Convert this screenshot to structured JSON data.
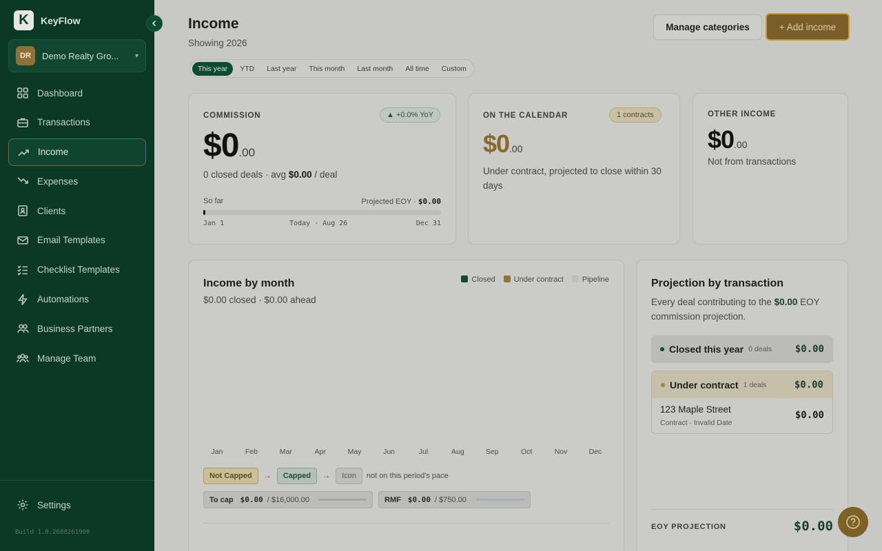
{
  "app": {
    "name": "KeyFlow",
    "logo_letter": "K",
    "build": "Build 1.0.2608261900"
  },
  "org": {
    "initials": "DR",
    "name": "Demo Realty Gro..."
  },
  "nav": [
    {
      "label": "Dashboard",
      "icon": "grid-icon"
    },
    {
      "label": "Transactions",
      "icon": "briefcase-icon"
    },
    {
      "label": "Income",
      "icon": "trend-up-icon",
      "active": true
    },
    {
      "label": "Expenses",
      "icon": "trend-down-icon"
    },
    {
      "label": "Clients",
      "icon": "contacts-icon"
    },
    {
      "label": "Email Templates",
      "icon": "mail-icon"
    },
    {
      "label": "Checklist Templates",
      "icon": "checklist-icon"
    },
    {
      "label": "Automations",
      "icon": "bolt-icon"
    },
    {
      "label": "Business Partners",
      "icon": "partners-icon"
    },
    {
      "label": "Manage Team",
      "icon": "team-icon"
    }
  ],
  "settings_label": "Settings",
  "header": {
    "title": "Income",
    "subtitle": "Showing 2026",
    "manage_label": "Manage categories",
    "add_label": "+ Add income"
  },
  "ranges": [
    "This year",
    "YTD",
    "Last year",
    "This month",
    "Last month",
    "All time",
    "Custom"
  ],
  "commission": {
    "label": "COMMISSION",
    "yoy": "▲ +0.0% YoY",
    "amount": "$0",
    "cents": ".00",
    "deals_prefix": "0 closed deals · avg ",
    "avg": "$0.00",
    "deals_suffix": " / deal",
    "so_far": "So far",
    "projected_label": "Projected EOY · ",
    "projected_value": "$0.00",
    "start": "Jan 1",
    "today": "Today · Aug 26",
    "end": "Dec 31",
    "progress": 0.0
  },
  "calendar": {
    "label": "ON THE CALENDAR",
    "badge": "1 contracts",
    "amount": "$0",
    "cents": ".00",
    "desc": "Under contract, projected to close within 30 days"
  },
  "other": {
    "label": "OTHER INCOME",
    "amount": "$0",
    "cents": ".00",
    "desc": "Not from transactions"
  },
  "by_month": {
    "title": "Income by month",
    "summary": "$0.00 closed · $0.00 ahead",
    "legend": [
      {
        "label": "Closed",
        "color": "#0f4a33"
      },
      {
        "label": "Under contract",
        "color": "#8c7444"
      },
      {
        "label": "Pipeline",
        "color": "#bfbfbb"
      }
    ],
    "months": [
      "Jan",
      "Feb",
      "Mar",
      "Apr",
      "May",
      "Jun",
      "Jul",
      "Aug",
      "Sep",
      "Oct",
      "Nov",
      "Dec"
    ],
    "chips": {
      "not_capped": "Not Capped",
      "capped": "Capped",
      "icon": "Icon",
      "note": "not on this period's pace"
    },
    "to_cap": {
      "label": "To cap",
      "value": "$0.00",
      "total": "/ $16,000.00"
    },
    "rmf": {
      "label": "RMF",
      "value": "$0.00",
      "total": "/ $750.00"
    }
  },
  "chart_data": {
    "type": "bar",
    "categories": [
      "Jan",
      "Feb",
      "Mar",
      "Apr",
      "May",
      "Jun",
      "Jul",
      "Aug",
      "Sep",
      "Oct",
      "Nov",
      "Dec"
    ],
    "series": [
      {
        "name": "Closed",
        "values": [
          0,
          0,
          0,
          0,
          0,
          0,
          0,
          0,
          0,
          0,
          0,
          0
        ]
      },
      {
        "name": "Under contract",
        "values": [
          0,
          0,
          0,
          0,
          0,
          0,
          0,
          0,
          0,
          0,
          0,
          0
        ]
      },
      {
        "name": "Pipeline",
        "values": [
          0,
          0,
          0,
          0,
          0,
          0,
          0,
          0,
          0,
          0,
          0,
          0
        ]
      }
    ],
    "title": "Income by month",
    "legend": "top-right"
  },
  "projection": {
    "title": "Projection by transaction",
    "desc_prefix": "Every deal contributing to the ",
    "desc_value": "$0.00",
    "desc_suffix": " EOY commission projection.",
    "closed": {
      "label": "Closed this year",
      "count": "0 deals",
      "amount": "$0.00"
    },
    "under": {
      "label": "Under contract",
      "count": "1 deals",
      "amount": "$0.00"
    },
    "item": {
      "name": "123 Maple Street",
      "meta": "Contract · Invalid Date",
      "amount": "$0.00"
    },
    "eoy_label": "EOY PROJECTION",
    "eoy_value": "$0.00"
  }
}
